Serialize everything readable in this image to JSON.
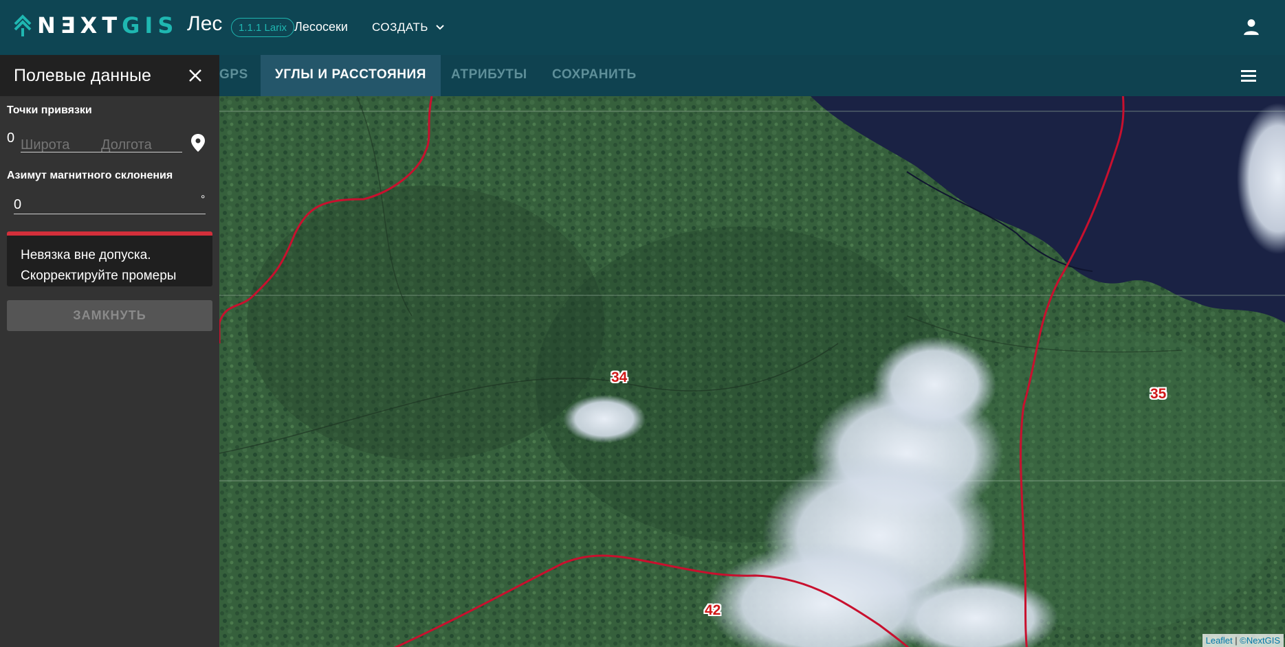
{
  "header": {
    "logo_prefix": "N",
    "logo_e": "Ǝ",
    "logo_x": "X",
    "logo_t": "T",
    "logo_suffix": "GIS",
    "app_name": "Лес",
    "version": "1.1.1 Larix",
    "section": "Лесосеки",
    "create_menu": "СОЗДАТЬ"
  },
  "tabs": [
    {
      "label": "GPS",
      "active": false
    },
    {
      "label": "УГЛЫ И РАССТОЯНИЯ",
      "active": true
    },
    {
      "label": "АТРИБУТЫ",
      "active": false
    },
    {
      "label": "СОХРАНИТЬ",
      "active": false
    }
  ],
  "panel": {
    "title": "Полевые данные",
    "anchor_label": "Точки привязки",
    "point_index": "0",
    "lat_placeholder": "Широта",
    "lon_placeholder": "Долгота",
    "azimuth_label": "Азимут магнитного склонения",
    "azimuth_value": "0",
    "degree_symbol": "°",
    "alert_text": "Невязка вне допуска. Скорректируйте промеры",
    "close_button": "ЗАМКНУТЬ"
  },
  "map": {
    "quarters": [
      "34",
      "35",
      "42"
    ],
    "attribution_leaflet": "Leaflet",
    "attribution_separator": "|",
    "attribution_nextgis": "©NextGIS"
  },
  "colors": {
    "header_bg": "#0e4553",
    "accent": "#1fb7b1",
    "panel_bg": "#333333",
    "alert_border": "#d32f3b",
    "boundary": "#c8102e"
  },
  "icons": [
    "nextgis-logo-icon",
    "chevron-down-icon",
    "user-icon",
    "hamburger-menu-icon",
    "close-icon",
    "location-pin-icon"
  ]
}
